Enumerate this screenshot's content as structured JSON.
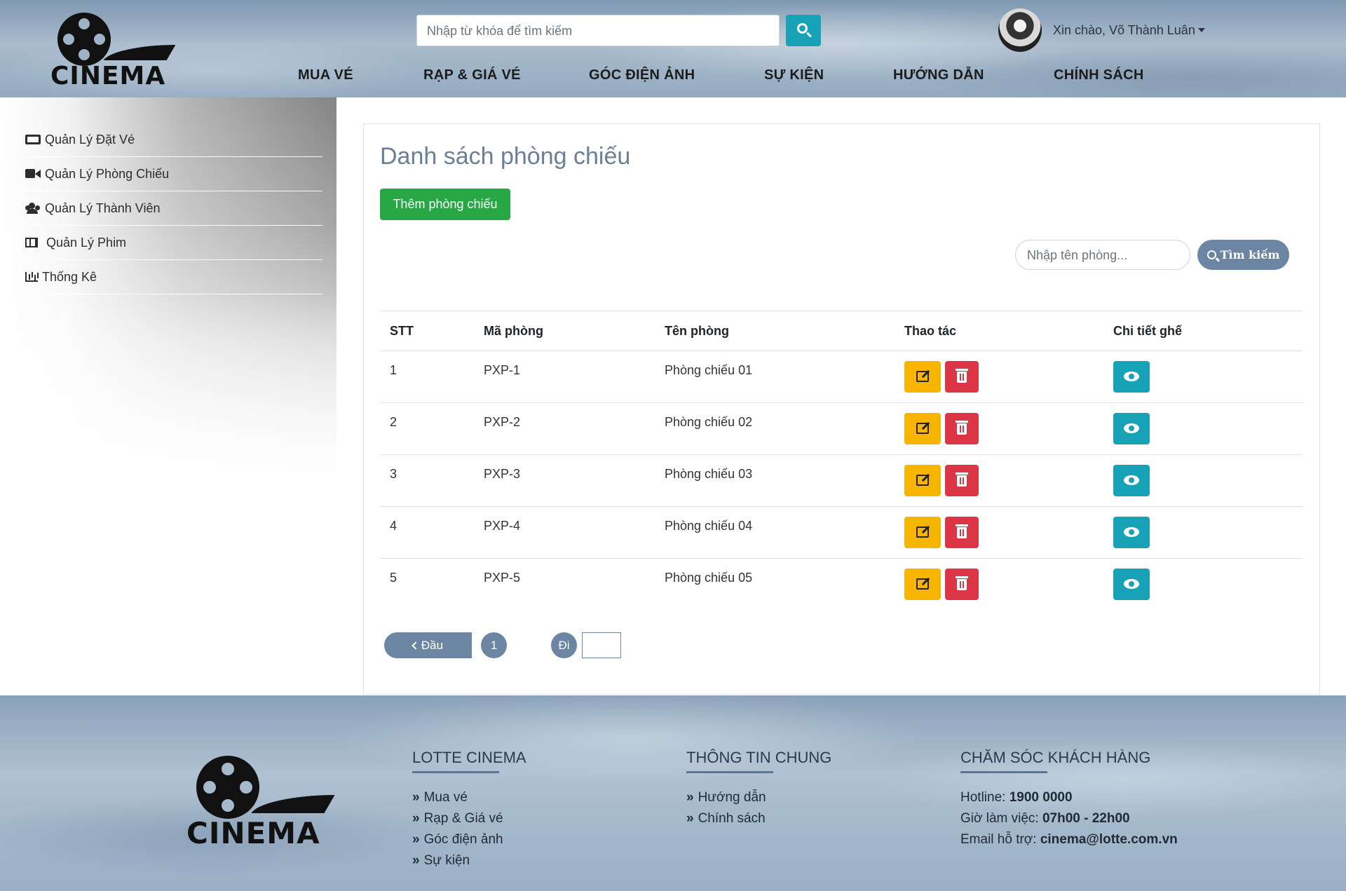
{
  "header": {
    "logo_text": "CINEMA",
    "search_placeholder": "Nhập từ khóa để tìm kiếm",
    "greeting": "Xin chào, Võ Thành Luân",
    "nav": [
      "MUA VÉ",
      "RẠP & GIÁ VÉ",
      "GÓC ĐIỆN ẢNH",
      "SỰ KIỆN",
      "HƯỚNG DẪN",
      "CHÍNH SÁCH"
    ]
  },
  "sidebar": {
    "items": [
      {
        "label": "Quản Lý Đặt Vé",
        "icon": "ticket-icon"
      },
      {
        "label": "Quản Lý Phòng Chiếu",
        "icon": "video-icon"
      },
      {
        "label": "Quản Lý Thành Viên",
        "icon": "users-icon"
      },
      {
        "label": "Quản Lý Phim",
        "icon": "film-icon"
      },
      {
        "label": "Thống Kê",
        "icon": "bar-chart-icon"
      }
    ]
  },
  "main": {
    "title": "Danh sách phòng chiếu",
    "add_button": "Thêm phòng chiếu",
    "room_search_placeholder": "Nhập tên phòng...",
    "room_search_button": "Tìm kiếm",
    "table": {
      "headers": [
        "STT",
        "Mã phòng",
        "Tên phòng",
        "Thao tác",
        "Chi tiết ghế"
      ],
      "rows": [
        {
          "stt": "1",
          "code": "PXP-1",
          "name": "Phòng chiếu 01"
        },
        {
          "stt": "2",
          "code": "PXP-2",
          "name": "Phòng chiếu 02"
        },
        {
          "stt": "3",
          "code": "PXP-3",
          "name": "Phòng chiếu 03"
        },
        {
          "stt": "4",
          "code": "PXP-4",
          "name": "Phòng chiếu 04"
        },
        {
          "stt": "5",
          "code": "PXP-5",
          "name": "Phòng chiếu 05"
        }
      ]
    },
    "pagination": {
      "first_label": "Đầu",
      "current_page": "1",
      "go_label": "Đi",
      "go_value": ""
    }
  },
  "footer": {
    "logo_text": "CINEMA",
    "col1": {
      "title": "LOTTE CINEMA",
      "links": [
        "Mua vé",
        "Rạp & Giá vé",
        "Góc điện ảnh",
        "Sự kiện"
      ]
    },
    "col2": {
      "title": "THÔNG TIN CHUNG",
      "links": [
        "Hướng dẫn",
        "Chính sách"
      ]
    },
    "col3": {
      "title": "CHĂM SÓC KHÁCH HÀNG",
      "hotline_label": "Hotline:",
      "hotline": "1900 0000",
      "hours_label": "Giờ làm việc:",
      "hours": "07h00 - 22h00",
      "email_label": "Email hỗ trợ:",
      "email": "cinema@lotte.com.vn"
    }
  },
  "colors": {
    "accent_teal": "#17a2b8",
    "success_green": "#28a745",
    "warning_yellow": "#f7b500",
    "danger_red": "#dc3545",
    "slate_blue": "#6b85a3"
  }
}
